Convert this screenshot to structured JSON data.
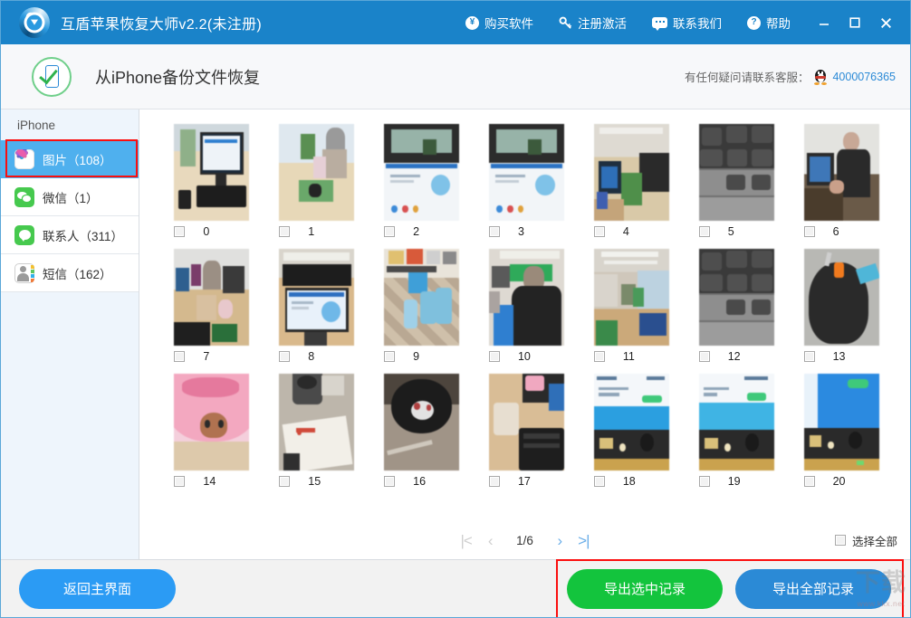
{
  "titlebar": {
    "app_title": "互盾苹果恢复大师v2.2(未注册)",
    "logo_icon": "app-logo-icon",
    "menu": [
      {
        "label": "购买软件",
        "icon": "yen-circle-icon"
      },
      {
        "label": "注册激活",
        "icon": "key-icon"
      },
      {
        "label": "联系我们",
        "icon": "chat-bubble-icon"
      },
      {
        "label": "帮助",
        "icon": "question-circle-icon"
      }
    ],
    "window_controls": {
      "minimize": "minimize-icon",
      "maximize": "maximize-icon",
      "close": "close-icon"
    }
  },
  "header": {
    "badge_icon": "phone-check-icon",
    "title": "从iPhone备份文件恢复",
    "support_text": "有任何疑问请联系客服：",
    "qq_icon": "qq-penguin-icon",
    "support_number": "4000076365"
  },
  "sidebar": {
    "caption": "iPhone",
    "items": [
      {
        "label": "图片（108）",
        "icon": "photos-icon",
        "active": true
      },
      {
        "label": "微信（1）",
        "icon": "wechat-icon",
        "active": false
      },
      {
        "label": "联系人（311）",
        "icon": "contacts-icon",
        "active": false
      },
      {
        "label": "短信（162）",
        "icon": "sms-icon",
        "active": false
      }
    ]
  },
  "grid": {
    "items": [
      {
        "index": "0",
        "checked": false
      },
      {
        "index": "1",
        "checked": false
      },
      {
        "index": "2",
        "checked": false
      },
      {
        "index": "3",
        "checked": false
      },
      {
        "index": "4",
        "checked": false
      },
      {
        "index": "5",
        "checked": false
      },
      {
        "index": "6",
        "checked": false
      },
      {
        "index": "7",
        "checked": false
      },
      {
        "index": "8",
        "checked": false
      },
      {
        "index": "9",
        "checked": false
      },
      {
        "index": "10",
        "checked": false
      },
      {
        "index": "11",
        "checked": false
      },
      {
        "index": "12",
        "checked": false
      },
      {
        "index": "13",
        "checked": false
      },
      {
        "index": "14",
        "checked": false
      },
      {
        "index": "15",
        "checked": false
      },
      {
        "index": "16",
        "checked": false
      },
      {
        "index": "17",
        "checked": false
      },
      {
        "index": "18",
        "checked": false
      },
      {
        "index": "19",
        "checked": false
      },
      {
        "index": "20",
        "checked": false
      }
    ]
  },
  "pager": {
    "first_label": "|<",
    "prev_label": "‹",
    "page_label": "1/6",
    "next_label": "›",
    "last_label": ">|",
    "select_all_label": "选择全部",
    "select_all_checked": false
  },
  "footer": {
    "back_label": "返回主界面",
    "export_selected_label": "导出选中记录",
    "export_all_label": "导出全部记录"
  },
  "watermark": {
    "main": "下载",
    "sub": "www.kkx.net"
  },
  "colors": {
    "titlebar_blue": "#1a83c9",
    "sidebar_active_blue": "#4fb0ee",
    "annotation_red": "#fb0e0e",
    "button_green": "#13c43d",
    "button_blue": "#2b9bf4",
    "link_blue": "#2b8ad6"
  }
}
